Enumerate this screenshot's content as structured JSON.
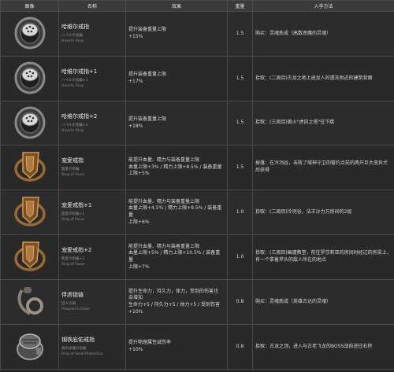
{
  "headers": {
    "image": "图像",
    "name": "名称",
    "effect": "效果",
    "weight": "重量",
    "source": "入手方法"
  },
  "rings": [
    {
      "icon": "havel-ring-icon",
      "name": "哈维尔戒指",
      "jp": "ハベルの指輪",
      "en": "Havel's Ring",
      "effect": [
        "提升装备重量上限",
        "+15%"
      ],
      "weight": "1.5",
      "source": "购买：灵魂炼成（高数恶魔的灵魂）"
    },
    {
      "icon": "havel-ring-icon",
      "name": "哈维尔戒指+1",
      "jp": "ハベルの指輪+1",
      "en": "Havel's Ring",
      "effect": [
        "提升装备重量上限",
        "+17%"
      ],
      "weight": "1.5",
      "source": "拾取：(二周目)古龙之地上途龙人的遗灰附近的建筑背面"
    },
    {
      "icon": "havel-ring-icon",
      "name": "哈维尔戒指+2",
      "jp": "ハベルの指輪+2",
      "en": "Havel's Ring",
      "effect": [
        "提升装备重量上限",
        "+18%"
      ],
      "weight": "1.5",
      "source": "拾取：(三周目)黄火\"虎囚之塔\"往下跳"
    },
    {
      "icon": "favor-ring-icon",
      "name": "宠爱戒指",
      "jp": "寵愛の指輪",
      "en": "Ring of Favor",
      "effect": [
        "能提升血量、精力与装备重量上限",
        "血量上限+3% / 精力上限+8.5% / 装备重量",
        "上限+5%"
      ],
      "weight": "1.5",
      "source": "掉落：在冷冽谷，击败了喊神守卫的誓约点前的两只巨大变异犬后获得"
    },
    {
      "icon": "favor-ring-icon",
      "name": "宠爱戒指+1",
      "jp": "寵愛の指輪+1",
      "en": "Ring of Favor",
      "effect": [
        "能提升血量、精力与装备重量上限",
        "血量上限+4.5% / 精力上限+9.5% / 装备重量",
        "上限+6%"
      ],
      "weight": "1.0",
      "source": "拾取：(二周目)冷冽谷，法王沙力万房间的2层"
    },
    {
      "icon": "favor-ring-icon",
      "name": "宠爱戒指+2",
      "jp": "寵愛の指輪+2",
      "en": "Ring of Favor",
      "effect": [
        "能提升血量、精力与装备重量上限",
        "血量上限+5% / 精力上限+10.5% / 装备重量",
        "上限+7%"
      ],
      "weight": "1.0",
      "source": "拾取：(三周目)幽邃教堂，前往罗莎莉亚的房间时经过的房梁上，有一个拿着斧头的敌人所在的地点"
    },
    {
      "icon": "prisoner-chain-icon",
      "name": "俘虏锁链",
      "jp": "囚人の鎖",
      "en": "Prisoner's Chain",
      "effect": [
        "提升生命力，持久力，体力，受到的伤害也",
        "会增加",
        "生命力+5 / 持久力+5 / 体力+5 / 受到伤害",
        "+10%"
      ],
      "weight": "0.8",
      "source": "购买：灵魂炼成（英雄古达的灵魂）"
    },
    {
      "icon": "steel-protection-icon",
      "name": "钢铁庇佑戒指",
      "jp": "鉄の加護の指輪",
      "en": "Ring of Steel Protection",
      "effect": [
        "提升物理属性减伤率",
        "+10%"
      ],
      "weight": "0.8",
      "source": "拾取：古龙之顶，进入与古老飞龙的BOSS战前进往右转"
    }
  ]
}
